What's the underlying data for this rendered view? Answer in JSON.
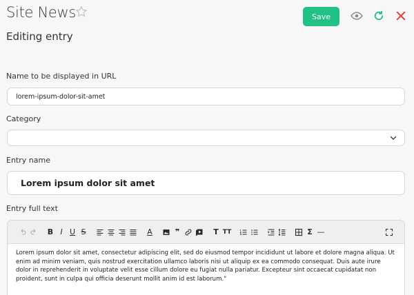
{
  "header": {
    "title": "Site News",
    "subtitle": "Editing entry",
    "save_label": "Save",
    "colors": {
      "save": "#1fc184",
      "refresh": "#1fc184",
      "close": "#e0453a",
      "eye": "#8a8a8a"
    }
  },
  "form": {
    "url_label": "Name to be displayed in URL",
    "url_value": "lorem-ipsum-dolor-sit-amet",
    "category_label": "Category",
    "category_value": "",
    "entry_name_label": "Entry name",
    "entry_name_value": "Lorem ipsum dolor sit amet",
    "full_text_label": "Entry full text",
    "full_text_value": "Lorem ipsum dolor sit amet, consectetur adipiscing elit, sed do eiusmod tempor incididunt ut labore et dolore magna aliqua. Ut enim ad minim veniam, quis nostrud exercitation ullamco laboris nisi ut aliquip ex ea commodo consequat. Duis aute irure dolor in reprehenderit in voluptate velit esse cillum dolore eu fugiat nulla pariatur. Excepteur sint occaecat cupidatat non proident, sunt in culpa qui officia deserunt mollit anim id est laborum.\""
  },
  "toolbar": {
    "bold": "B",
    "italic": "I",
    "underline": "U",
    "strike": "S",
    "text_color": "A",
    "quote": "❞",
    "heading": "T",
    "text_size": "TT",
    "sigma": "Σ",
    "hr": "—",
    "icons": [
      "undo-icon",
      "redo-icon",
      "bold-icon",
      "italic-icon",
      "underline-icon",
      "strikethrough-icon",
      "align-left-icon",
      "align-center-icon",
      "align-right-icon",
      "align-justify-icon",
      "text-color-icon",
      "image-icon",
      "quote-icon",
      "link-icon",
      "media-icon",
      "heading-icon",
      "font-size-icon",
      "ordered-list-icon",
      "unordered-list-icon",
      "indent-icon",
      "line-height-icon",
      "table-icon",
      "sigma-icon",
      "horizontal-rule-icon",
      "fullscreen-icon"
    ]
  }
}
